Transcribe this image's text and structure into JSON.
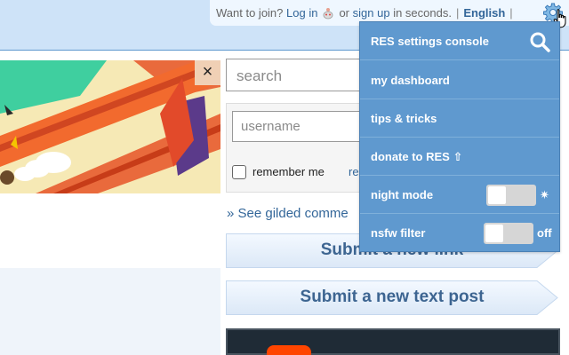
{
  "userbar": {
    "want_to_join": "Want to join?",
    "login": "Log in",
    "or": "or",
    "signup": "sign up",
    "in_seconds": "in seconds.",
    "separator": "|",
    "language": "English"
  },
  "icons": {
    "gear": "gear-icon",
    "snoo": "snoo-icon",
    "close": "close-icon",
    "search": "search-icon",
    "cursor": "hand-cursor-icon"
  },
  "banner": {
    "close": "×"
  },
  "sidebar": {
    "search_placeholder": "search",
    "username_placeholder": "username",
    "remember_me": "remember me",
    "reset_partial": "re",
    "gilded": "» See gilded comme",
    "submit_link": "Submit a new link",
    "submit_text": "Submit a new text post"
  },
  "res_menu": {
    "items": [
      {
        "label": "RES settings console"
      },
      {
        "label": "my dashboard"
      },
      {
        "label": "tips & tricks"
      },
      {
        "label": "donate to RES ⇧"
      },
      {
        "label": "night mode",
        "toggle_on": false,
        "suffix": "✷"
      },
      {
        "label": "nsfw filter",
        "toggle_on": false,
        "suffix": "off"
      }
    ]
  },
  "colors": {
    "header_bg": "#cee3f8",
    "menu_bg": "#5f99cf",
    "link": "#336699",
    "submit_text": "#3d6591"
  }
}
